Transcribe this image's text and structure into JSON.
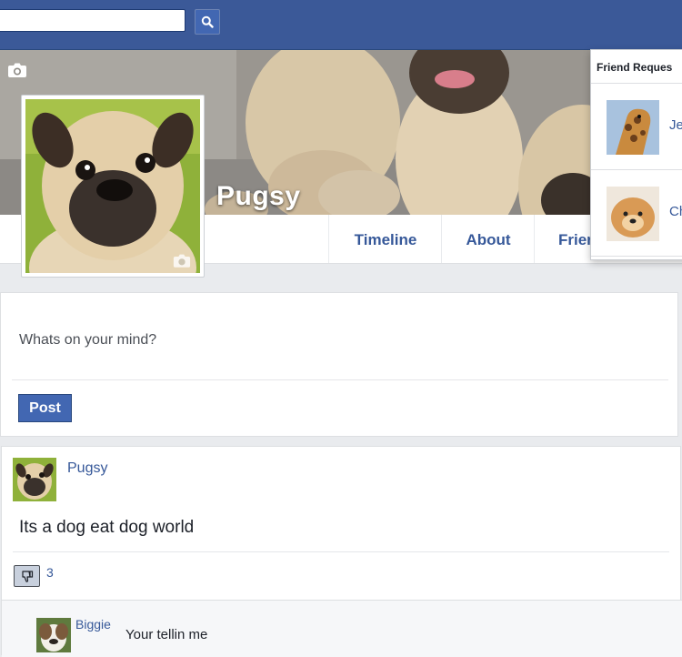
{
  "header": {
    "search": {
      "value": "",
      "placeholder": ""
    },
    "search_button_icon": "search-icon"
  },
  "profile": {
    "name": "Pugsy",
    "cover_camera_icon": "camera-icon",
    "picture_camera_icon": "camera-icon"
  },
  "nav": {
    "tabs": [
      {
        "label": "Timeline"
      },
      {
        "label": "About"
      },
      {
        "label": "Frien"
      }
    ]
  },
  "friend_requests": {
    "title": "Friend Reques",
    "items": [
      {
        "name": "Je"
      },
      {
        "name": "Ch"
      }
    ]
  },
  "composer": {
    "placeholder": "Whats on your mind?",
    "post_label": "Post"
  },
  "post": {
    "author": "Pugsy",
    "text": "Its a dog eat dog world",
    "like_icon": "thumbs-down-icon",
    "like_count": "3",
    "comment": {
      "author": "Biggie",
      "text": "Your tellin me"
    }
  },
  "colors": {
    "brand": "#3b5998",
    "link": "#365899",
    "button": "#4267b2",
    "page_bg": "#e9ebee"
  }
}
